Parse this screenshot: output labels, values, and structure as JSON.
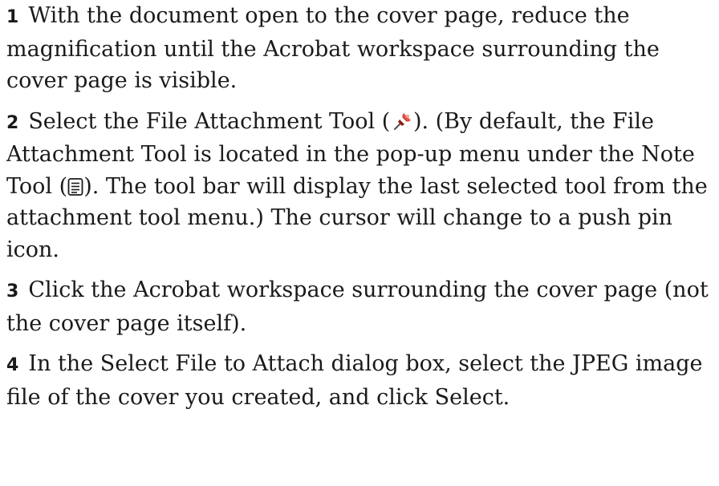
{
  "steps": [
    {
      "number": "1",
      "text": "With the document open to the cover page, reduce the magnification until the Acrobat workspace surrounding the cover page is visible."
    },
    {
      "number": "2",
      "text_1": "Select the File Attachment Tool (",
      "text_2": "). (By default, the File Attachment Tool is located in the pop-up menu under the Note Tool (",
      "text_3": "). The tool bar will display the last selected tool from the attachment tool menu.) The cursor will change to a push pin icon.",
      "icon_1": "push-pin-icon",
      "icon_2": "note-icon"
    },
    {
      "number": "3",
      "text": "Click the Acrobat workspace surrounding the cover page (not the cover page itself)."
    },
    {
      "number": "4",
      "text": "In the Select File to Attach dialog box, select the JPEG image file of the cover you created, and click Select."
    }
  ],
  "colors": {
    "text": "#1a1a1a",
    "pin_head": "#c0392b",
    "pin_needle": "#555555"
  }
}
